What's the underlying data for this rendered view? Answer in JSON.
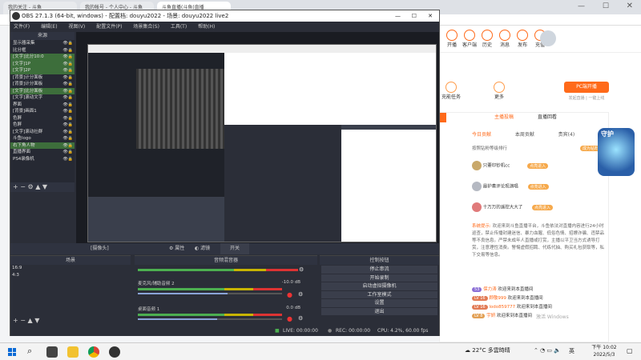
{
  "browser": {
    "tabs": [
      "我的关注 - 斗鱼",
      "我的帐号 - 个人中心 - 斗鱼",
      "斗鱼直播(斗鱼)直播",
      "..."
    ],
    "nav": [
      "开播",
      "客户端",
      "历史",
      "消息",
      "发布",
      "充值"
    ],
    "banner_items": [
      "鱼吧",
      "鱼乐",
      "充能任务",
      "更多"
    ],
    "pc_label": "PC端开播",
    "pc_sub": "发起直播 | 一键上线",
    "chat_tabs": [
      "主播投稿",
      "直播回看"
    ],
    "rank_tabs": [
      "今日贡献",
      "本周贡献",
      "贵宾(4)",
      "钻粉"
    ],
    "rank_header": "按照钻粉等级排行",
    "rank_badge": "成为钻粉",
    "rank_users": [
      "只要印钞机cc",
      "最护奏评论现演唱",
      "十万万的遥控大大了"
    ],
    "rank_btn": "点亮进入",
    "system_notice_label": "系统提示:",
    "system_notice": "欢迎来到斗鱼直播平台，斗鱼依法对直播内容进行24小时巡查，禁止传播封建迷信、暴力血腥、低俗色情、招嫖诈骗、违禁品等不良信息。严禁未成年人直播或打赏，主播以平卫当方式诱导打赏，注意理性消费。警惕虚假招聘、代练代抽、购买礼包获取等，私下交易等信息。",
    "chat_msgs": [
      {
        "lv": "53",
        "name": "保力涛",
        "msg": "欢迎来到本直播间"
      },
      {
        "lv": "LV 16",
        "name": "顾敬999",
        "msg": "欢迎来到本直播间"
      },
      {
        "lv": "LV 16",
        "name": "lodo859777",
        "msg": "欢迎来到本直播间"
      },
      {
        "lv": "LV 8",
        "name": "宇妍",
        "msg": "欢迎来到本直播间"
      }
    ],
    "watermark": "激活 Windows",
    "shouhu": "守护"
  },
  "obs": {
    "title": "OBS 27.1.3 (64-bit, windows) - 配置档: douyu2022 - 场景: douyu2022 live2",
    "menu": [
      "文件(F)",
      "编辑(E)",
      "视图(V)",
      "配置文件(P)",
      "场景集合(S)",
      "工具(T)",
      "帮助(H)"
    ],
    "sources_header": "来源",
    "sources": [
      {
        "name": "显示器采集",
        "hl": false
      },
      {
        "name": "比分框",
        "hl": false
      },
      {
        "name": "[文字]比分10:0",
        "hl": true
      },
      {
        "name": "[文字]1P",
        "hl": true
      },
      {
        "name": "[文字]2P",
        "hl": true
      },
      {
        "name": "[背景]计分面板",
        "hl": false
      },
      {
        "name": "[背景]计分面板",
        "hl": false
      },
      {
        "name": "[文字]比分面板",
        "hl": true
      },
      {
        "name": "[文字]滚动文字",
        "hl": false
      },
      {
        "name": "界面",
        "hl": false
      },
      {
        "name": "[背景]画面1",
        "hl": false
      },
      {
        "name": "色屏",
        "hl": false
      },
      {
        "name": "色屏",
        "hl": false
      },
      {
        "name": "[文字]滚动社群",
        "hl": false
      },
      {
        "name": "斗鱼logo",
        "hl": false
      },
      {
        "name": "右下角人物",
        "hl": true
      },
      {
        "name": "直播界面",
        "hl": false
      },
      {
        "name": "PS4录像机",
        "hl": false
      }
    ],
    "scene_toolbar": [
      "[摄像头]",
      "属性",
      "滤镜",
      "开关"
    ],
    "scenes_header": "场景",
    "scenes": [
      "16:9",
      "4:3"
    ],
    "mixer_header": "音频混音器",
    "mixer": [
      {
        "name": "麦克风/辅助音频 2",
        "db": "-10.0 dB",
        "level": 0.62
      },
      {
        "name": "桌面音频 1",
        "db": "0.0 dB",
        "level": 0.55
      }
    ],
    "controls_header": "控制按钮",
    "controls": [
      "停止串流",
      "开始录制",
      "启动虚拟摄像机",
      "工作室模式",
      "设置",
      "退出"
    ],
    "status": {
      "live": "LIVE: 00:00:00",
      "rec": "REC: 00:00:00",
      "cpu": "CPU: 4.2%, 60.00 fps"
    }
  },
  "taskbar": {
    "weather": "22°C  多雲時晴",
    "time": "下午 10:02",
    "date": "2022/5/3",
    "lang": "英"
  }
}
